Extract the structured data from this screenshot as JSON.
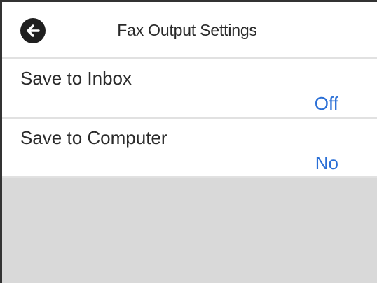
{
  "header": {
    "title": "Fax Output Settings",
    "back_icon": "arrow-left-icon"
  },
  "settings": [
    {
      "label": "Save to Inbox",
      "value": "Off"
    },
    {
      "label": "Save to Computer",
      "value": "No"
    }
  ],
  "colors": {
    "value_text": "#2a6fd6",
    "empty_area": "#d9d9d9",
    "back_button": "#1f1f1f"
  }
}
